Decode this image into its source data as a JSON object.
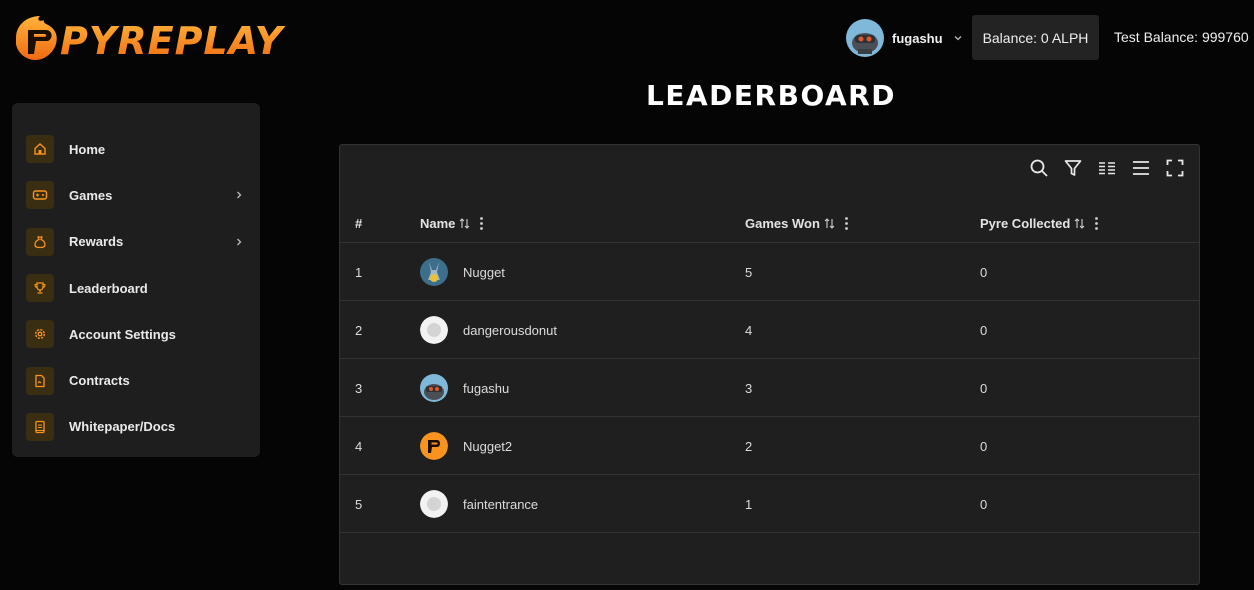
{
  "brand": {
    "logo_text": "PYREPLAY",
    "accent": "#f7931e"
  },
  "header": {
    "username": "fugashu",
    "balance": "Balance: 0 ALPH",
    "test_balance": "Test Balance: 999760"
  },
  "page": {
    "title": "LEADERBOARD"
  },
  "sidebar": {
    "items": [
      {
        "label": "Home",
        "icon": "home-icon"
      },
      {
        "label": "Games",
        "icon": "gamepad-icon",
        "has_submenu": true
      },
      {
        "label": "Rewards",
        "icon": "money-bag-icon",
        "has_submenu": true
      },
      {
        "label": "Leaderboard",
        "icon": "trophy-icon"
      },
      {
        "label": "Account Settings",
        "icon": "gear-icon"
      },
      {
        "label": "Contracts",
        "icon": "document-icon"
      },
      {
        "label": "Whitepaper/Docs",
        "icon": "book-icon"
      }
    ]
  },
  "toolbar": {
    "icons": [
      "search-icon",
      "filter-icon",
      "density-icon",
      "columns-icon",
      "fullscreen-icon"
    ]
  },
  "table": {
    "columns": [
      "#",
      "Name",
      "Games Won",
      "Pyre Collected"
    ],
    "rows": [
      {
        "rank": "1",
        "name": "Nugget",
        "avatar": "nugget-avatar",
        "games_won": "5",
        "pyre": "0"
      },
      {
        "rank": "2",
        "name": "dangerousdonut",
        "avatar": "default-avatar",
        "games_won": "4",
        "pyre": "0"
      },
      {
        "rank": "3",
        "name": "fugashu",
        "avatar": "fugashu-avatar",
        "games_won": "3",
        "pyre": "0"
      },
      {
        "rank": "4",
        "name": "Nugget2",
        "avatar": "pyre-logo-avatar",
        "games_won": "2",
        "pyre": "0"
      },
      {
        "rank": "5",
        "name": "faintentrance",
        "avatar": "default-avatar",
        "games_won": "1",
        "pyre": "0"
      }
    ]
  }
}
